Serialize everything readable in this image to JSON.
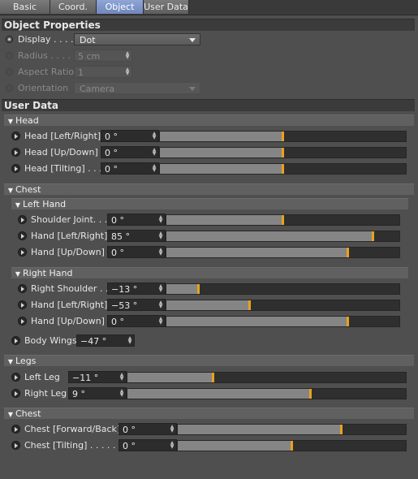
{
  "tabs": [
    {
      "label": "Basic",
      "active": false
    },
    {
      "label": "Coord.",
      "active": false
    },
    {
      "label": "Object",
      "active": true
    },
    {
      "label": "User Data",
      "active": false
    }
  ],
  "object_properties": {
    "title": "Object Properties",
    "display": {
      "label": "Display . . . . .",
      "value": "Dot"
    },
    "radius": {
      "label": "Radius . . . . .",
      "value": "5 cm"
    },
    "aspect_ratio": {
      "label": "Aspect Ratio",
      "value": "1"
    },
    "orientation": {
      "label": "Orientation",
      "value": "Camera"
    }
  },
  "user_data": {
    "title": "User Data",
    "head": {
      "title": "Head",
      "rows": [
        {
          "label": "Head [Left/Right]",
          "value": "0 °",
          "level": 0.5
        },
        {
          "label": "Head [Up/Down]",
          "value": "0 °",
          "level": 0.5
        },
        {
          "label": "Head [Tilting] . . .",
          "value": "0 °",
          "level": 0.5
        }
      ]
    },
    "chest": {
      "title": "Chest",
      "left_hand": {
        "title": "Left Hand",
        "rows": [
          {
            "label": "Shoulder Joint. . .",
            "value": "0 °",
            "level": 0.5
          },
          {
            "label": "Hand [Left/Right]",
            "value": "85 °",
            "level": 0.89
          },
          {
            "label": "Hand [Up/Down]",
            "value": "0 °",
            "level": 0.78
          }
        ]
      },
      "right_hand": {
        "title": "Right Hand",
        "rows": [
          {
            "label": "Right Shoulder . .",
            "value": "−13 °",
            "level": 0.14
          },
          {
            "label": "Hand [Left/Right]",
            "value": "−53 °",
            "level": 0.36
          },
          {
            "label": "Hand [Up/Down]",
            "value": "0 °",
            "level": 0.78
          }
        ]
      },
      "body_wings": {
        "label": "Body Wings",
        "value": "−47 °"
      }
    },
    "legs": {
      "title": "Legs",
      "rows": [
        {
          "label": "Left Leg",
          "value": "−11 °",
          "level": 0.31
        },
        {
          "label": "Right Leg",
          "value": "9 °",
          "level": 0.66
        }
      ]
    },
    "chest2": {
      "title": "Chest",
      "rows": [
        {
          "label": "Chest [Forward/Back]",
          "value": "0 °",
          "level": 0.72
        },
        {
          "label": "Chest [Tilting] . . . . . .",
          "value": "0 °",
          "level": 0.5
        }
      ]
    }
  },
  "colors": {
    "accent": "#e8a21c",
    "tab_active": "#7b93c9"
  }
}
